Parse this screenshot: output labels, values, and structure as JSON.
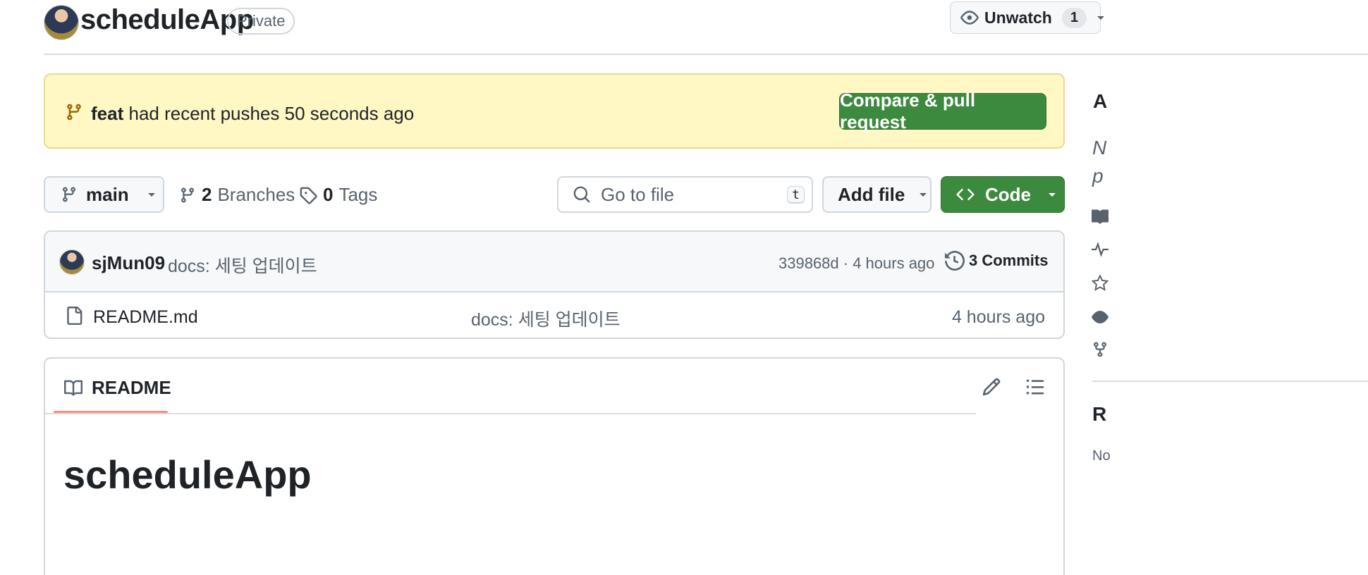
{
  "header": {
    "repo_name": "scheduleApp",
    "visibility": "Private",
    "watch": {
      "label": "Unwatch",
      "count": "1"
    }
  },
  "banner": {
    "branch": "feat",
    "message": "had recent pushes 50 seconds ago",
    "button_label": "Compare & pull request"
  },
  "toolbar": {
    "branch_label": "main",
    "branches": {
      "count": "2",
      "label": "Branches"
    },
    "tags": {
      "count": "0",
      "label": "Tags"
    },
    "search_placeholder": "Go to file",
    "search_shortcut": "t",
    "add_file_label": "Add file",
    "code_label": "Code"
  },
  "latest_commit": {
    "author": "sjMun09",
    "message": "docs: 세팅 업데이트",
    "hash_time": "339868d · 4 hours ago",
    "commits_label": "3 Commits"
  },
  "files": [
    {
      "name": "README.md",
      "message": "docs: 세팅 업데이트",
      "time": "4 hours ago"
    }
  ],
  "readme": {
    "tab_label": "README",
    "heading_partial": "scheduleApp"
  },
  "sidebar": {
    "about_partial": "A",
    "desc_line1": "N",
    "desc_line2": "p",
    "releases_partial": "R",
    "releases_sub_partial": "No"
  },
  "colors": {
    "accent_green": "#3b8a3e",
    "banner_bg": "#fff8c5",
    "tab_underline": "#fd8c73",
    "muted_text": "#59636e"
  }
}
